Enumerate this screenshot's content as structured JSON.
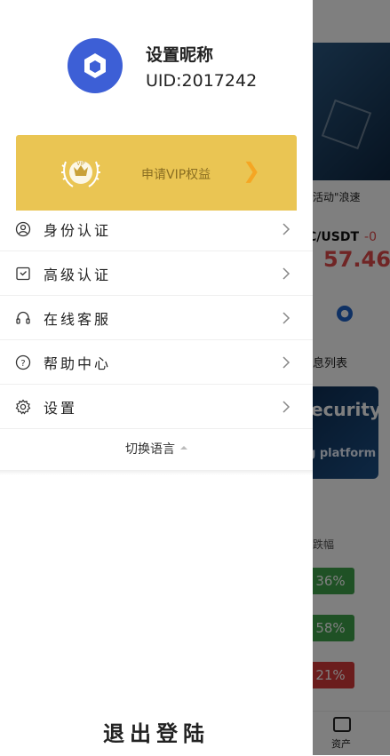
{
  "background": {
    "news_text": "活动\"浪速",
    "pair": "C/USDT",
    "pair_change": "-0",
    "price": "57.46",
    "msg_list": "息列表",
    "security_title": "ecurity",
    "security_sub": "g platform",
    "rank_label": "跌幅",
    "pills": [
      "36%",
      "58%",
      "21%"
    ],
    "tab_assets": "资产"
  },
  "drawer": {
    "nickname": "设置昵称",
    "uid": "UID:2017242",
    "vip_label": "申请VIP权益",
    "vip_badge_text": "VIP",
    "menu": [
      {
        "label": "身份认证",
        "icon": "user-circle-icon"
      },
      {
        "label": "高级认证",
        "icon": "badge-check-icon"
      },
      {
        "label": "在线客服",
        "icon": "headset-icon"
      },
      {
        "label": "帮助中心",
        "icon": "help-circle-icon"
      },
      {
        "label": "设置",
        "icon": "gear-icon"
      }
    ],
    "language": "切换语言",
    "logout": "退出登陆"
  },
  "colors": {
    "avatar": "#3d5fd6",
    "vip_bg": "#eac553",
    "price_red": "#e04b4b",
    "gain_green": "#3fa24a"
  }
}
